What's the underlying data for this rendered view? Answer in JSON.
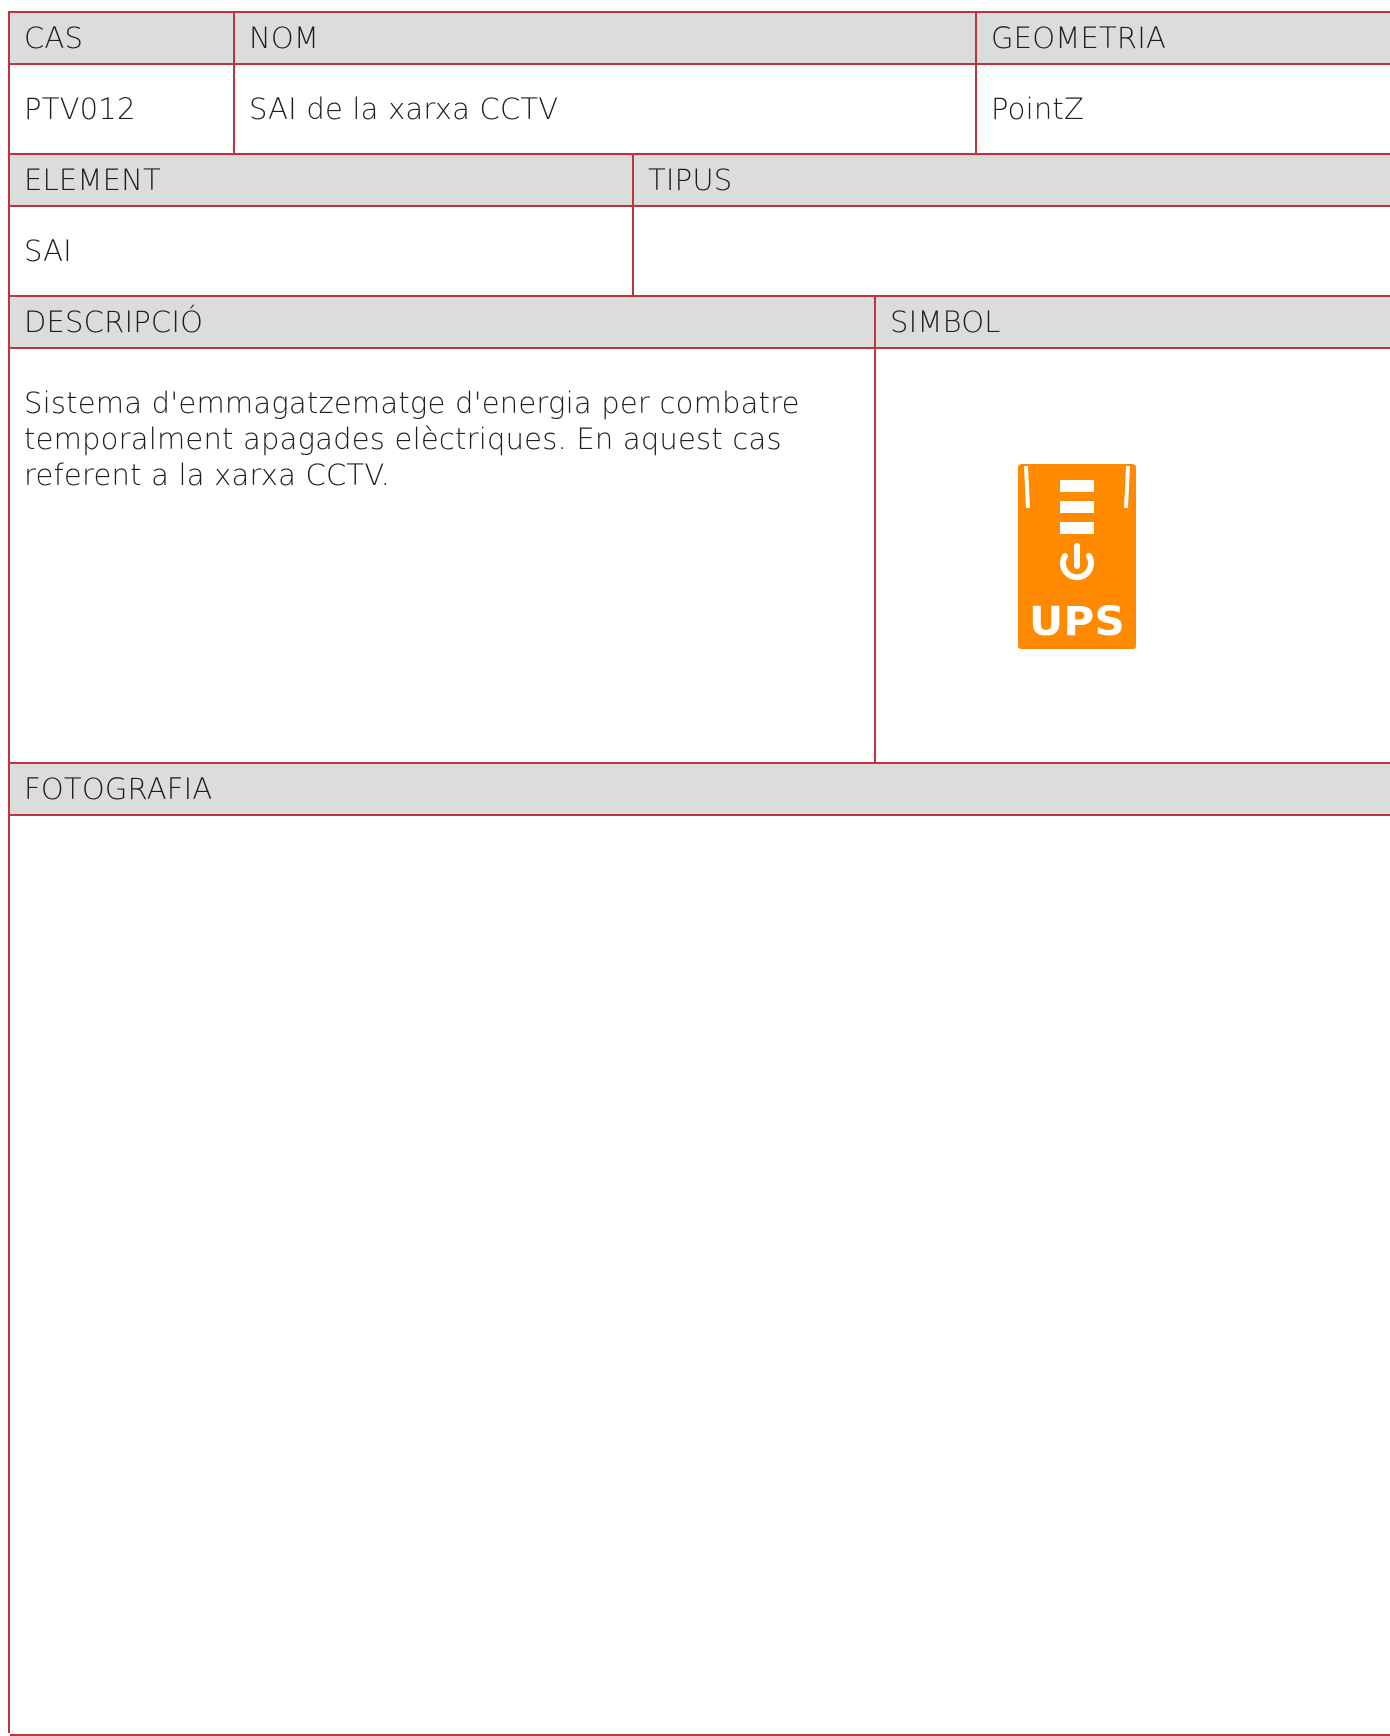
{
  "row1": {
    "cas_header": "CAS",
    "nom_header": "NOM",
    "geometria_header": "GEOMETRIA",
    "cas_value": "PTV012",
    "nom_value": "SAI de la xarxa CCTV",
    "geometria_value": "PointZ"
  },
  "row2": {
    "element_header": "ELEMENT",
    "tipus_header": "TIPUS",
    "element_value": "SAI",
    "tipus_value": ""
  },
  "row3": {
    "descripcio_header": "DESCRIPCIÓ",
    "simbol_header": "SIMBOL",
    "descripcio_value": "Sistema d'emmagatzematge d'energia per combatre temporalment apagades elèctriques. En aquest cas referent a la xarxa CCTV.",
    "symbol": {
      "icon": "ups-icon",
      "label": "UPS",
      "color": "#ff8a00"
    }
  },
  "row4": {
    "fotografia_header": "FOTOGRAFIA"
  }
}
